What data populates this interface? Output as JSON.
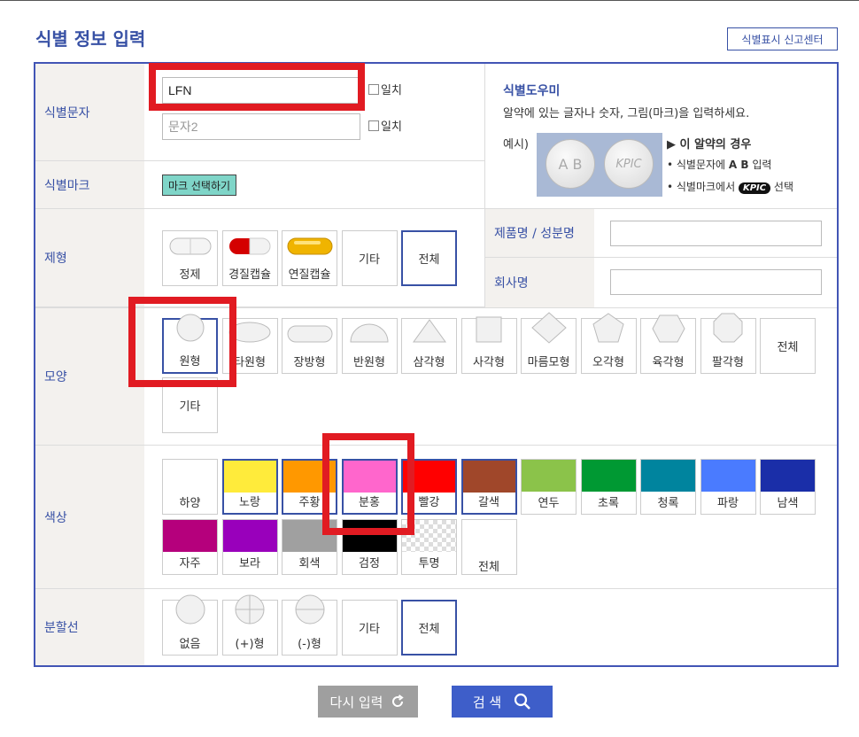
{
  "title": "식별 정보 입력",
  "report_button": "식별표시 신고센터",
  "rows": {
    "ident_char": "식별문자",
    "ident_mark": "식별마크",
    "form": "제형",
    "shape": "모양",
    "color": "색상",
    "score": "분할선"
  },
  "ident": {
    "input1_value": "LFN",
    "input2_placeholder": "문자2",
    "exact_label": "일치",
    "mark_button": "마크 선택하기"
  },
  "helper": {
    "title": "식별도우미",
    "desc": "알약에 있는 글자나 숫자, 그림(마크)을 입력하세요.",
    "example_label": "예시)",
    "pill_left": "A B",
    "pill_right": "KPIC",
    "case_title": "▶ 이 알약의 경우",
    "bullet1_pre": "• 식별문자에 ",
    "bullet1_bold": "A B",
    "bullet1_post": " 입력",
    "bullet2_pre": "• 식별마크에서 ",
    "bullet2_mark": "KPIC",
    "bullet2_post": " 선택"
  },
  "search_fields": {
    "product_label": "제품명 / 성분명",
    "company_label": "회사명"
  },
  "forms": [
    {
      "label": "정제",
      "icon": "tablet-icon"
    },
    {
      "label": "경질캡슐",
      "icon": "hard-capsule-icon"
    },
    {
      "label": "연질캡슐",
      "icon": "soft-capsule-icon"
    },
    {
      "label": "기타",
      "icon": ""
    },
    {
      "label": "전체",
      "icon": "",
      "selected": true
    }
  ],
  "shapes": [
    {
      "label": "원형",
      "icon": "circle-icon",
      "selected": true
    },
    {
      "label": "타원형",
      "icon": "oval-icon",
      "selected": false
    },
    {
      "label": "장방형",
      "icon": "oblong-icon"
    },
    {
      "label": "반원형",
      "icon": "semicircle-icon"
    },
    {
      "label": "삼각형",
      "icon": "triangle-icon"
    },
    {
      "label": "사각형",
      "icon": "square-icon"
    },
    {
      "label": "마름모형",
      "icon": "diamond-icon"
    },
    {
      "label": "오각형",
      "icon": "pentagon-icon"
    },
    {
      "label": "육각형",
      "icon": "hexagon-icon"
    },
    {
      "label": "팔각형",
      "icon": "octagon-icon"
    },
    {
      "label": "전체",
      "icon": ""
    },
    {
      "label": "기타",
      "icon": ""
    }
  ],
  "colors": [
    {
      "label": "하양",
      "hex": "#ffffff",
      "selected": false
    },
    {
      "label": "노랑",
      "hex": "#ffeb3b",
      "selected": true
    },
    {
      "label": "주황",
      "hex": "#ff9800",
      "selected": true
    },
    {
      "label": "분홍",
      "hex": "#ff66cc",
      "selected": true
    },
    {
      "label": "빨강",
      "hex": "#ff0000",
      "selected": true
    },
    {
      "label": "갈색",
      "hex": "#a0472a",
      "selected": true
    },
    {
      "label": "연두",
      "hex": "#8bc34a"
    },
    {
      "label": "초록",
      "hex": "#009933"
    },
    {
      "label": "청록",
      "hex": "#00849e"
    },
    {
      "label": "파랑",
      "hex": "#4a7bff"
    },
    {
      "label": "남색",
      "hex": "#1a2ea8"
    },
    {
      "label": "자주",
      "hex": "#b5007c"
    },
    {
      "label": "보라",
      "hex": "#9900bb"
    },
    {
      "label": "회색",
      "hex": "#a0a0a0"
    },
    {
      "label": "검정",
      "hex": "#000000"
    },
    {
      "label": "투명",
      "hex": "checker"
    },
    {
      "label": "전체",
      "hex": ""
    }
  ],
  "scores": [
    {
      "label": "없음",
      "icon": "no-score-icon"
    },
    {
      "label": "(+)형",
      "icon": "plus-score-icon"
    },
    {
      "label": "(-)형",
      "icon": "minus-score-icon"
    },
    {
      "label": "기타",
      "icon": ""
    },
    {
      "label": "전체",
      "icon": "",
      "selected": true
    }
  ],
  "buttons": {
    "reset": "다시 입력",
    "search": "검 색"
  }
}
